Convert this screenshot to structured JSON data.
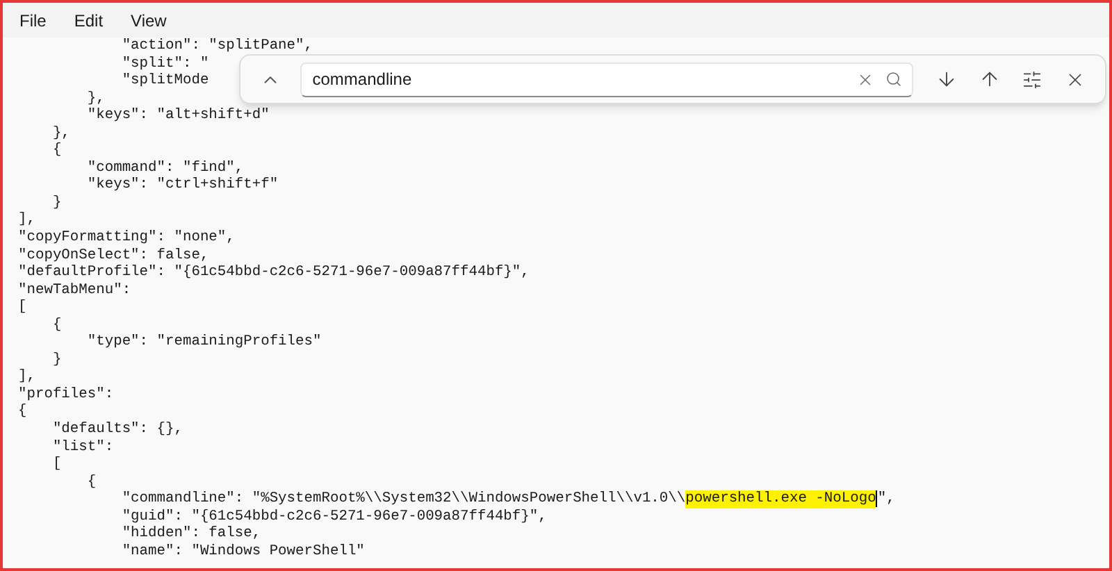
{
  "menu": [
    "File",
    "Edit",
    "View"
  ],
  "find_bar": {
    "value": "commandline"
  },
  "lines": [
    {
      "text": "            \"action\": \"splitPane\","
    },
    {
      "text": "            \"split\": \""
    },
    {
      "text": "            \"splitMode"
    },
    {
      "text": "        },"
    },
    {
      "text": "        \"keys\": \"alt+shift+d\""
    },
    {
      "text": "    },"
    },
    {
      "text": "    {"
    },
    {
      "text": "        \"command\": \"find\","
    },
    {
      "text": "        \"keys\": \"ctrl+shift+f\""
    },
    {
      "text": "    }"
    },
    {
      "text": "],"
    },
    {
      "text": "\"copyFormatting\": \"none\","
    },
    {
      "text": "\"copyOnSelect\": false,"
    },
    {
      "text": "\"defaultProfile\": \"{61c54bbd-c2c6-5271-96e7-009a87ff44bf}\","
    },
    {
      "text": "\"newTabMenu\":"
    },
    {
      "text": "["
    },
    {
      "text": "    {"
    },
    {
      "text": "        \"type\": \"remainingProfiles\""
    },
    {
      "text": "    }"
    },
    {
      "text": "],"
    },
    {
      "text": "\"profiles\":"
    },
    {
      "text": "{"
    },
    {
      "text": "    \"defaults\": {},"
    },
    {
      "text": "    \"list\":"
    },
    {
      "text": "    ["
    },
    {
      "text": "        {"
    },
    {
      "text": "            \"commandline\": \"%SystemRoot%\\\\System32\\\\WindowsPowerShell\\\\v1.0\\\\",
      "match": "powershell.exe -NoLogo",
      "after": "\","
    },
    {
      "text": "            \"guid\": \"{61c54bbd-c2c6-5271-96e7-009a87ff44bf}\","
    },
    {
      "text": "            \"hidden\": false,"
    },
    {
      "text": "            \"name\": \"Windows PowerShell\""
    }
  ]
}
